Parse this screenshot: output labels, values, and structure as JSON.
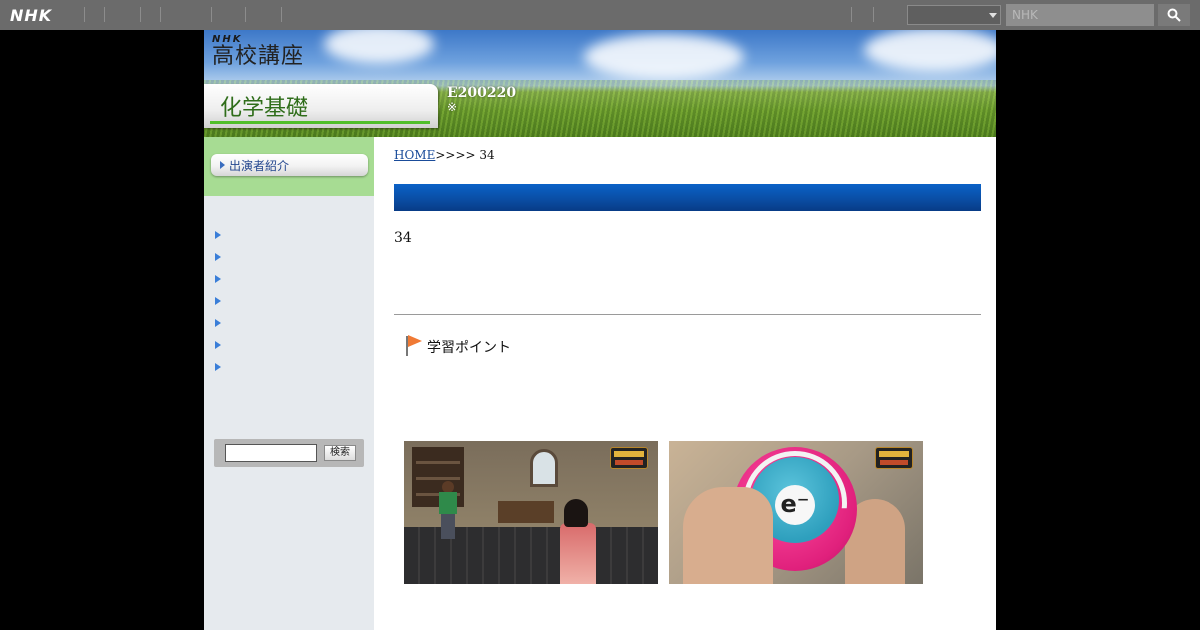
{
  "topbar": {
    "logo": "NHK",
    "search_placeholder": "NHK",
    "select_value": "",
    "search_icon": "search-icon"
  },
  "header": {
    "program_brand_mark": "NHK",
    "program_brand": "高校講座",
    "subject": "化学基礎",
    "code": "E200220",
    "note_mark": "※"
  },
  "sidebar": {
    "performer_link": "出演者紹介",
    "search_button": "検索",
    "search_value": ""
  },
  "main": {
    "breadcrumb_home": "HOME",
    "breadcrumb_rest": ">>>> 34",
    "episode_number": "34",
    "learning_point": "学習ポイント",
    "photo_logo_icon": "program-logo-icon",
    "electron_label": "e⁻"
  },
  "colors": {
    "topbar": "#6b6b6b",
    "sidebar_accent": "#a7dc93",
    "heading_bar": "#0a4ea5",
    "link": "#1a4c9a"
  }
}
